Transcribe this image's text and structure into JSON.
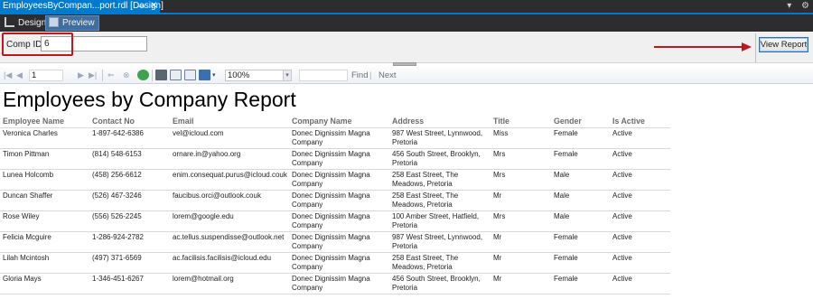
{
  "document_tab": {
    "title": "EmployeesByCompan...port.rdl [Design]",
    "pin_glyph": "⊸",
    "close_glyph": "✕"
  },
  "strip_right": {
    "dropdown_glyph": "▾",
    "settings_glyph": "⚙"
  },
  "mode_bar": {
    "design_label": "Design",
    "preview_label": "Preview"
  },
  "parameters": {
    "comp_id_label": "Comp ID",
    "comp_id_value": "6",
    "view_report_label": "View Report"
  },
  "toolbar": {
    "page_value": "1",
    "zoom_value": "100%",
    "find_label": "Find",
    "next_label": "Next"
  },
  "report": {
    "title": "Employees by Company Report",
    "columns": [
      "Employee Name",
      "Contact No",
      "Email",
      "Company Name",
      "Address",
      "Title",
      "Gender",
      "Is Active"
    ],
    "rows": [
      [
        "Veronica Charles",
        "1-897-642-6386",
        "vel@icloud.com",
        "Donec Dignissim Magna Company",
        "987 West Street,  Lynnwood, Pretoria",
        "Miss",
        "Female",
        "Active"
      ],
      [
        "Timon Pittman",
        "(814) 548-6153",
        "ornare.in@yahoo.org",
        "Donec Dignissim Magna Company",
        "456 South Street, Brooklyn, Pretoria",
        "Mrs",
        "Female",
        "Active"
      ],
      [
        "Lunea Holcomb",
        "(458) 256-6612",
        "enim.consequat.purus@icloud.couk",
        "Donec Dignissim Magna Company",
        "258 East Street,  The Meadows, Pretoria",
        "Mrs",
        "Male",
        "Active"
      ],
      [
        "Duncan Shaffer",
        "(526) 467-3246",
        "faucibus.orci@outlook.couk",
        "Donec Dignissim Magna Company",
        "258 East Street,  The Meadows, Pretoria",
        "Mr",
        "Male",
        "Active"
      ],
      [
        "Rose Wiley",
        "(556) 526-2245",
        "lorem@google.edu",
        "Donec Dignissim Magna Company",
        "100 Amber Street, Hatfield, Pretoria",
        "Mrs",
        "Male",
        "Active"
      ],
      [
        "Felicia Mcguire",
        "1-286-924-2782",
        "ac.tellus.suspendisse@outlook.net",
        "Donec Dignissim Magna Company",
        "987 West Street,  Lynnwood, Pretoria",
        "Mr",
        "Female",
        "Active"
      ],
      [
        "Lilah Mcintosh",
        "(497) 371-6569",
        "ac.facilisis.facilisis@icloud.edu",
        "Donec Dignissim Magna Company",
        "258 East Street,  The Meadows, Pretoria",
        "Mr",
        "Female",
        "Active"
      ],
      [
        "Gloria Mays",
        "1-346-451-6267",
        "lorem@hotmail.org",
        "Donec Dignissim Magna Company",
        "456 South Street, Brooklyn, Pretoria",
        "Mr",
        "Female",
        "Active"
      ]
    ]
  },
  "colors": {
    "accent_blue": "#007acc",
    "annotation_red": "#c0161c",
    "ide_dark": "#2d2d30"
  }
}
